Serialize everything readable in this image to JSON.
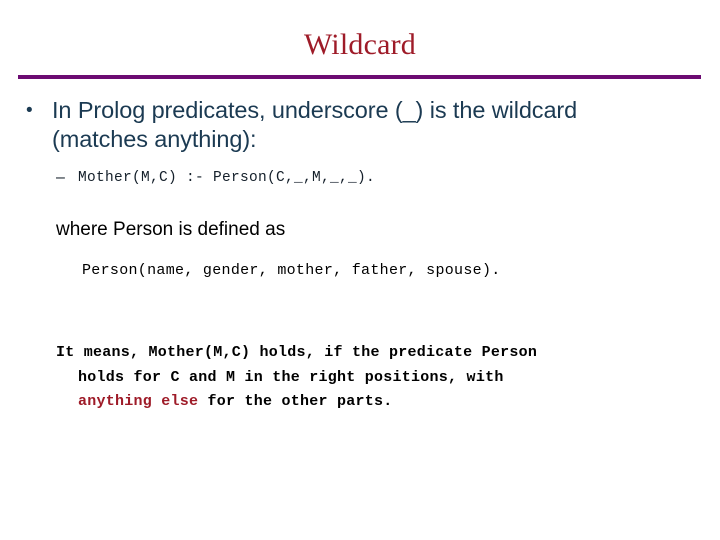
{
  "slide": {
    "title": "Wildcard",
    "accent_title_color": "#9E1B28",
    "accent_rule_color": "#6C0B72",
    "body_text_color": "#1B3A52",
    "highlight_color": "#9E1B28",
    "bullets": [
      {
        "marker": "•",
        "line1": "In Prolog predicates, underscore (_) is the wildcard",
        "line2": "(matches anything):"
      }
    ],
    "sub_bullet": {
      "marker": "–",
      "code": "Mother(M,C) :- Person(C,_,M,_,_)."
    },
    "where_line": "where Person is defined as",
    "person_signature": "Person(name, gender, mother, father, spouse).",
    "explanation": {
      "line1": "It means, Mother(M,C) holds, if the predicate Person",
      "line2": "holds for C and M in the right positions, with",
      "line3_highlight": "anything else",
      "line3_rest": " for the other parts."
    }
  }
}
